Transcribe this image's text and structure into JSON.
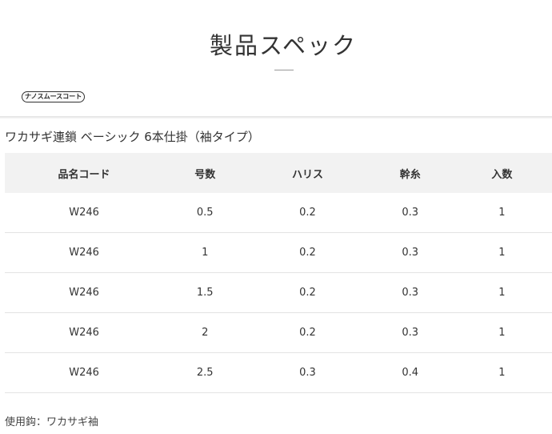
{
  "header": {
    "title": "製品スペック",
    "badge": "ナノスムースコート"
  },
  "product": {
    "name": "ワカサギ連鎖 ベーシック 6本仕掛（袖タイプ）"
  },
  "table": {
    "columns": [
      "品名コード",
      "号数",
      "ハリス",
      "幹糸",
      "入数"
    ],
    "rows": [
      [
        "W246",
        "0.5",
        "0.2",
        "0.3",
        "1"
      ],
      [
        "W246",
        "1",
        "0.2",
        "0.3",
        "1"
      ],
      [
        "W246",
        "1.5",
        "0.2",
        "0.3",
        "1"
      ],
      [
        "W246",
        "2",
        "0.2",
        "0.3",
        "1"
      ],
      [
        "W246",
        "2.5",
        "0.3",
        "0.4",
        "1"
      ]
    ]
  },
  "footer": {
    "note": "使用鈎：ワカサギ袖"
  }
}
